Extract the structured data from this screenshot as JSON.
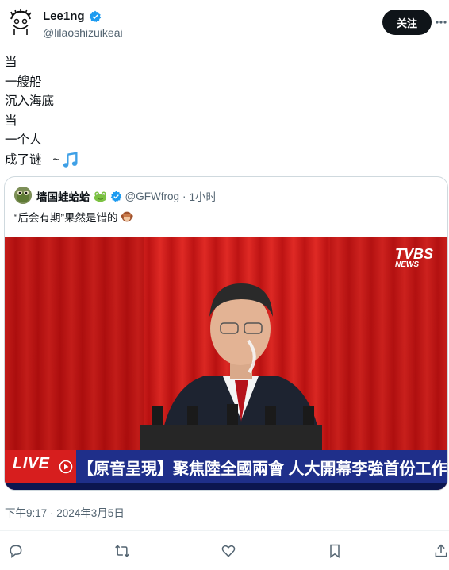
{
  "author": {
    "display_name": "Lee1ng",
    "handle": "@lilaoshizuikeai",
    "verified": true
  },
  "follow_button": {
    "label": "关注"
  },
  "post": {
    "lines": [
      "当",
      "一艘船",
      "沉入海底",
      "当",
      "一个人",
      "成了谜"
    ],
    "last_line_suffix": "~",
    "music_icon": "musical-note-icon"
  },
  "quote": {
    "display_name": "墙国蛙蛤蛤",
    "name_emoji": "frog-icon",
    "handle": "@GFWfrog",
    "separator": "·",
    "time": "1小时",
    "text": "“后会有期”果然是错的",
    "text_emoji": "see-no-evil-monkey-icon",
    "media": {
      "channel_logo": "TVBS",
      "channel_sub": "NEWS",
      "live_label": "LIVE",
      "ticker_text": "【原音呈現】聚焦陸全國兩會 人大開幕李強首份工作報告"
    }
  },
  "timestamp": "下午9:17 · 2024年3月5日",
  "actions": [
    "reply-icon",
    "retweet-icon",
    "like-icon",
    "bookmark-icon",
    "share-icon"
  ],
  "colors": {
    "verified": "#1d9bf0",
    "ticker_blue": "#1f2f8a",
    "live_red": "#d71e1e",
    "curtain_red": "#d51a1a"
  }
}
